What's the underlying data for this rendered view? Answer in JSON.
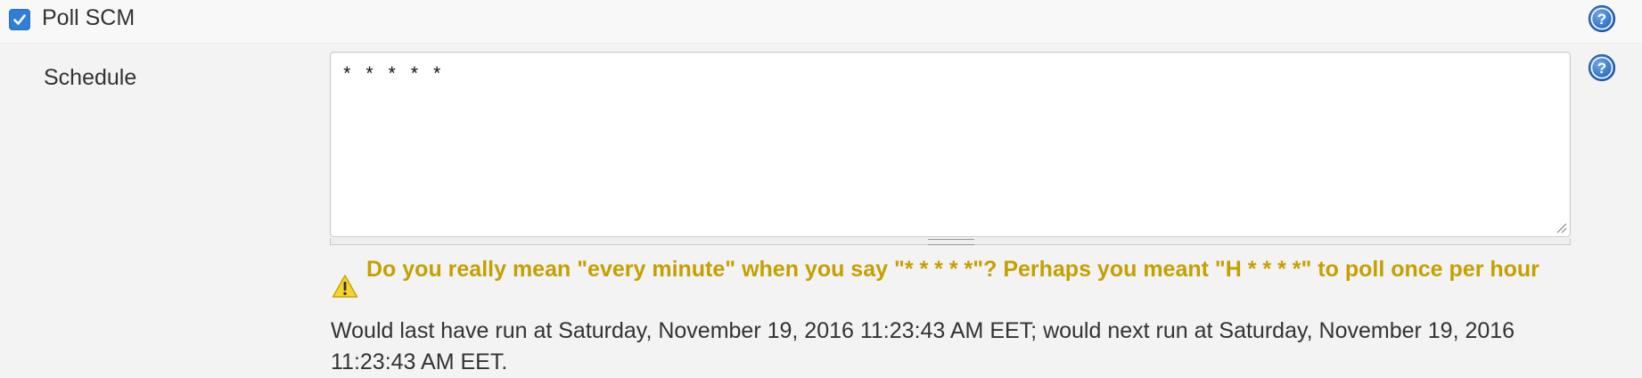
{
  "poll_scm": {
    "label": "Poll SCM",
    "checked": true
  },
  "schedule": {
    "label": "Schedule",
    "value": "* * * * *"
  },
  "validation": {
    "warning": "Do you really mean \"every minute\" when you say \"* * * * *\"? Perhaps you meant \"H * * * *\" to poll once per hour",
    "run_info": "Would last have run at Saturday, November 19, 2016 11:23:43 AM EET; would next run at Saturday, November 19, 2016 11:23:43 AM EET."
  },
  "icons": {
    "help": "help-icon",
    "check": "checkmark-icon",
    "warning": "warning-icon",
    "resize": "resize-grip-icon"
  },
  "colors": {
    "checkbox": "#2f7ed8",
    "help": "#2d6fc8",
    "warning_text": "#c4a000",
    "warning_icon": "#f5d432"
  }
}
